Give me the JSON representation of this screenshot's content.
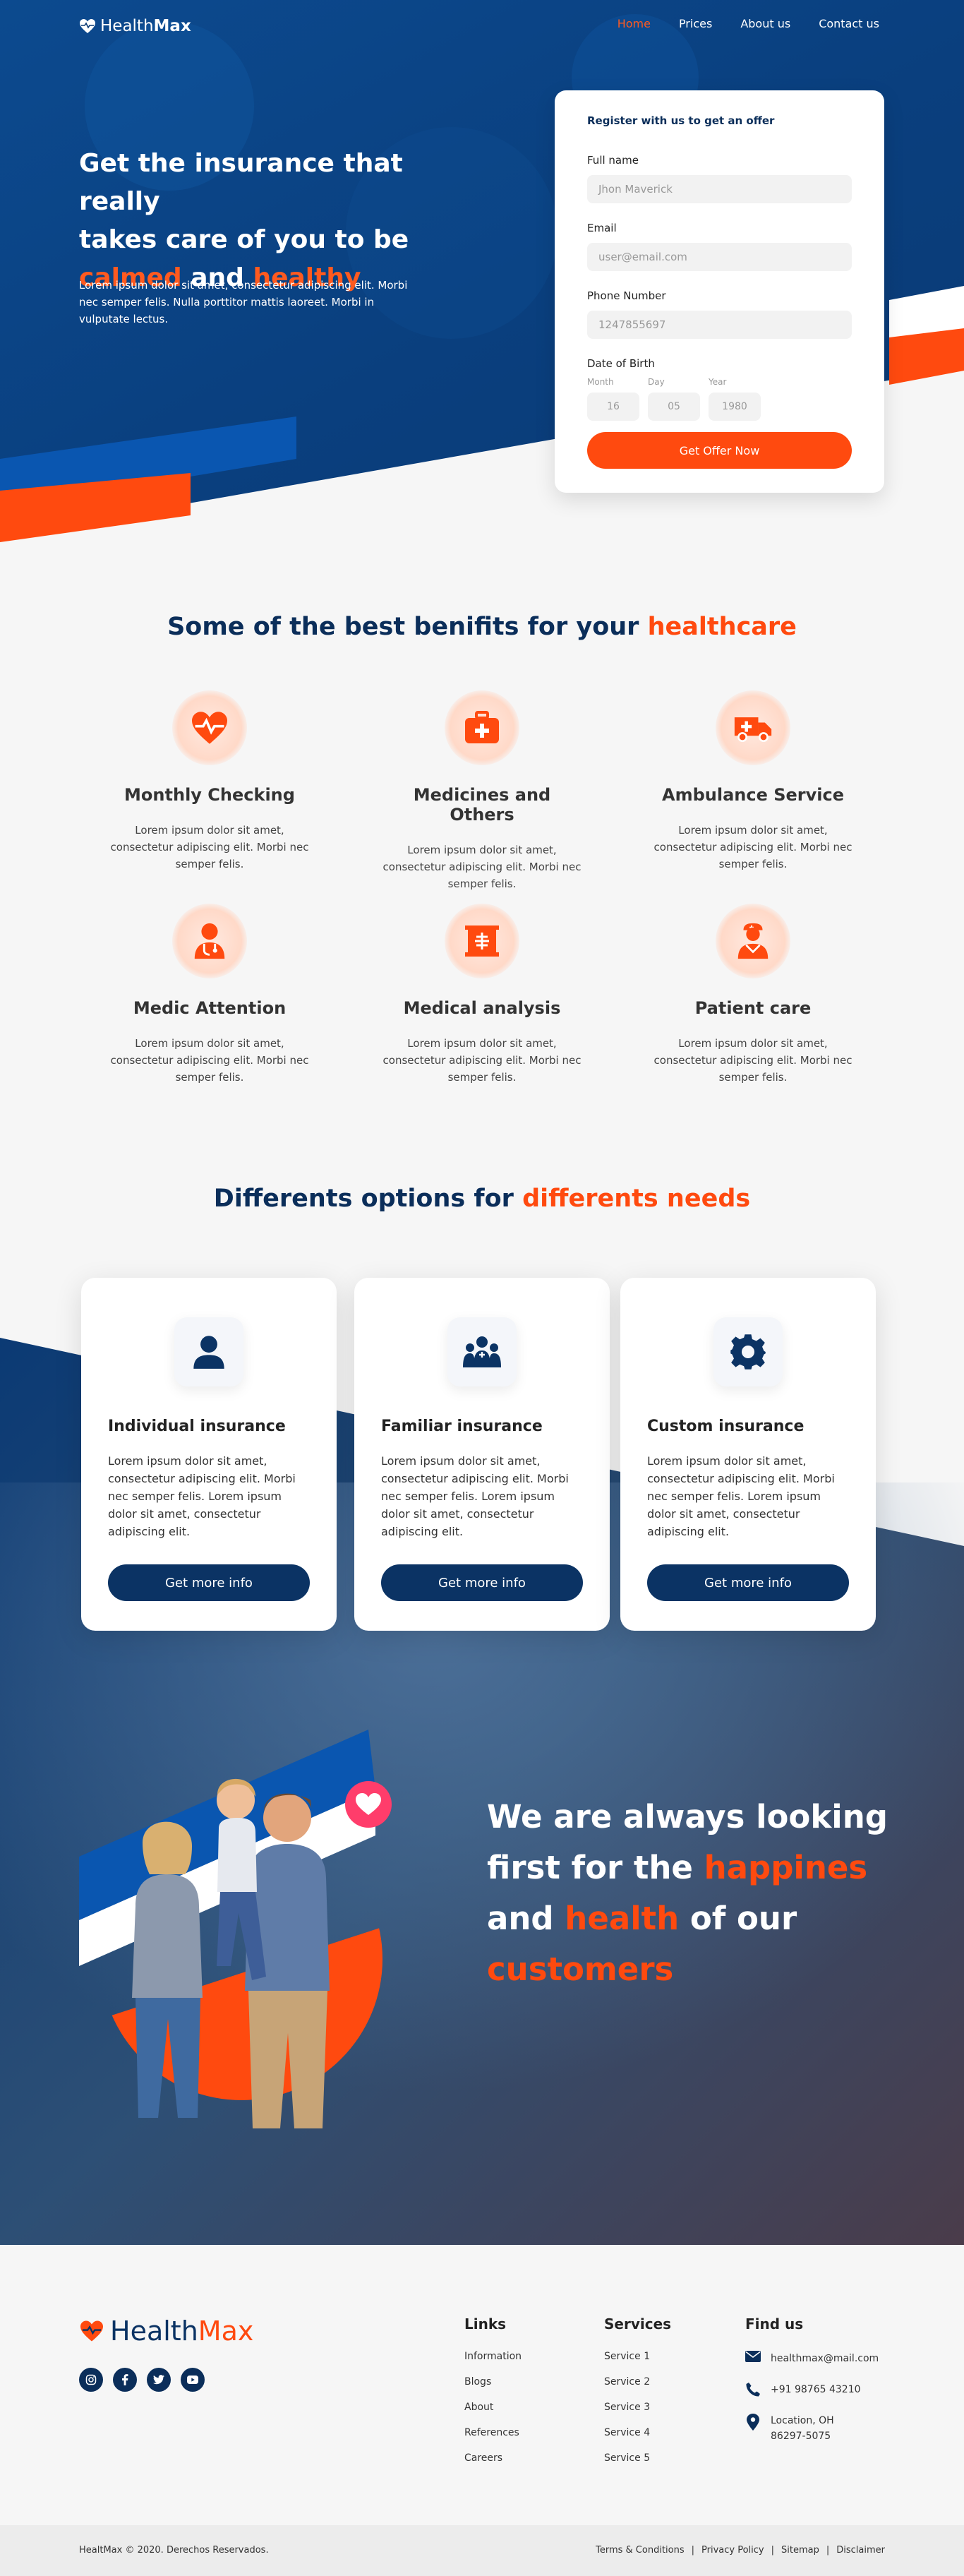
{
  "brand": {
    "name_light": "Health",
    "name_bold": "Max"
  },
  "nav": {
    "items": [
      {
        "label": "Home",
        "active": true
      },
      {
        "label": "Prices"
      },
      {
        "label": "About us"
      },
      {
        "label": "Contact us"
      }
    ]
  },
  "hero": {
    "title_line1": "Get the insurance that really",
    "title_line2": "takes care of you to be",
    "title_hl1": "calmed",
    "title_and": " and ",
    "title_hl2": "healthy",
    "text": "Lorem ipsum dolor sit amet, consectetur adipiscing elit. Morbi nec semper felis. Nulla porttitor mattis laoreet. Morbi in vulputate lectus."
  },
  "form": {
    "title": "Register with us to get an offer",
    "full_name_label": "Full name",
    "full_name_placeholder": "Jhon Maverick",
    "email_label": "Email",
    "email_placeholder": "user@email.com",
    "phone_label": "Phone Number",
    "phone_placeholder": "1247855697",
    "dob_label": "Date of Birth",
    "month_label": "Month",
    "month_value": "16",
    "day_label": "Day",
    "day_value": "05",
    "year_label": "Year",
    "year_value": "1980",
    "submit": "Get Offer Now"
  },
  "benefits": {
    "title": "Some of the best benifits for your ",
    "title_hl": "healthcare",
    "items": [
      {
        "title": "Monthly Checking",
        "icon": "heart-pulse-icon",
        "text": "Lorem ipsum dolor sit amet, consectetur adipiscing elit. Morbi nec semper felis."
      },
      {
        "title": "Medicines and Others",
        "icon": "medkit-icon",
        "text": "Lorem ipsum dolor sit amet, consectetur adipiscing elit. Morbi nec semper felis."
      },
      {
        "title": "Ambulance Service",
        "icon": "ambulance-icon",
        "text": "Lorem ipsum dolor sit amet, consectetur adipiscing elit. Morbi nec semper felis."
      },
      {
        "title": "Medic Attention",
        "icon": "doctor-icon",
        "text": "Lorem ipsum dolor sit amet, consectetur adipiscing elit. Morbi nec semper felis."
      },
      {
        "title": "Medical analysis",
        "icon": "x-ray-icon",
        "text": "Lorem ipsum dolor sit amet, consectetur adipiscing elit. Morbi nec semper felis."
      },
      {
        "title": "Patient care",
        "icon": "nurse-icon",
        "text": "Lorem ipsum dolor sit amet, consectetur adipiscing elit. Morbi nec semper felis."
      }
    ]
  },
  "options": {
    "title": "Differents options for ",
    "title_hl": "differents needs",
    "cards": [
      {
        "title": "Individual insurance",
        "icon": "user-icon",
        "text": "Lorem ipsum dolor sit amet, consectetur adipiscing elit. Morbi nec semper felis.  Lorem ipsum dolor sit amet, consectetur adipiscing elit.",
        "button": "Get  more info"
      },
      {
        "title": "Familiar insurance",
        "icon": "family-icon",
        "text": "Lorem ipsum dolor sit amet, consectetur adipiscing elit. Morbi nec semper felis.  Lorem ipsum dolor sit amet, consectetur adipiscing elit.",
        "button": "Get  more info"
      },
      {
        "title": "Custom insurance",
        "icon": "gear-icon",
        "text": "Lorem ipsum dolor sit amet, consectetur adipiscing elit. Morbi nec semper felis.  Lorem ipsum dolor sit amet, consectetur adipiscing elit.",
        "button": "Get  more info"
      }
    ]
  },
  "happiness": {
    "line1": "We are always looking",
    "line2": "first for the ",
    "line2_hl": "happines",
    "line3_pre": "and ",
    "line3_hl": "health",
    "line3_post": " of our",
    "line4_hl": "customers"
  },
  "footer": {
    "links_title": "Links",
    "links": [
      "Information",
      "Blogs",
      "About",
      "References",
      "Careers"
    ],
    "services_title": "Services",
    "services": [
      "Service 1",
      "Service 2",
      "Service 3",
      "Service 4",
      "Service 5"
    ],
    "find_title": "Find us",
    "email": "healthmax@mail.com",
    "phone": "+91 98765 43210",
    "location_line1": "Location, OH",
    "location_line2": "86297-5075",
    "social": [
      "instagram-icon",
      "facebook-icon",
      "twitter-icon",
      "youtube-icon"
    ]
  },
  "bottom": {
    "copyright": "HealtMax © 2020. Derechos Reservados.",
    "links": [
      "Terms & Conditions",
      "Privacy Policy",
      "Sitemap",
      "Disclaimer"
    ]
  },
  "colors": {
    "navy": "#0b3364",
    "orange": "#ff4a0f",
    "blue": "#0a4a97"
  }
}
